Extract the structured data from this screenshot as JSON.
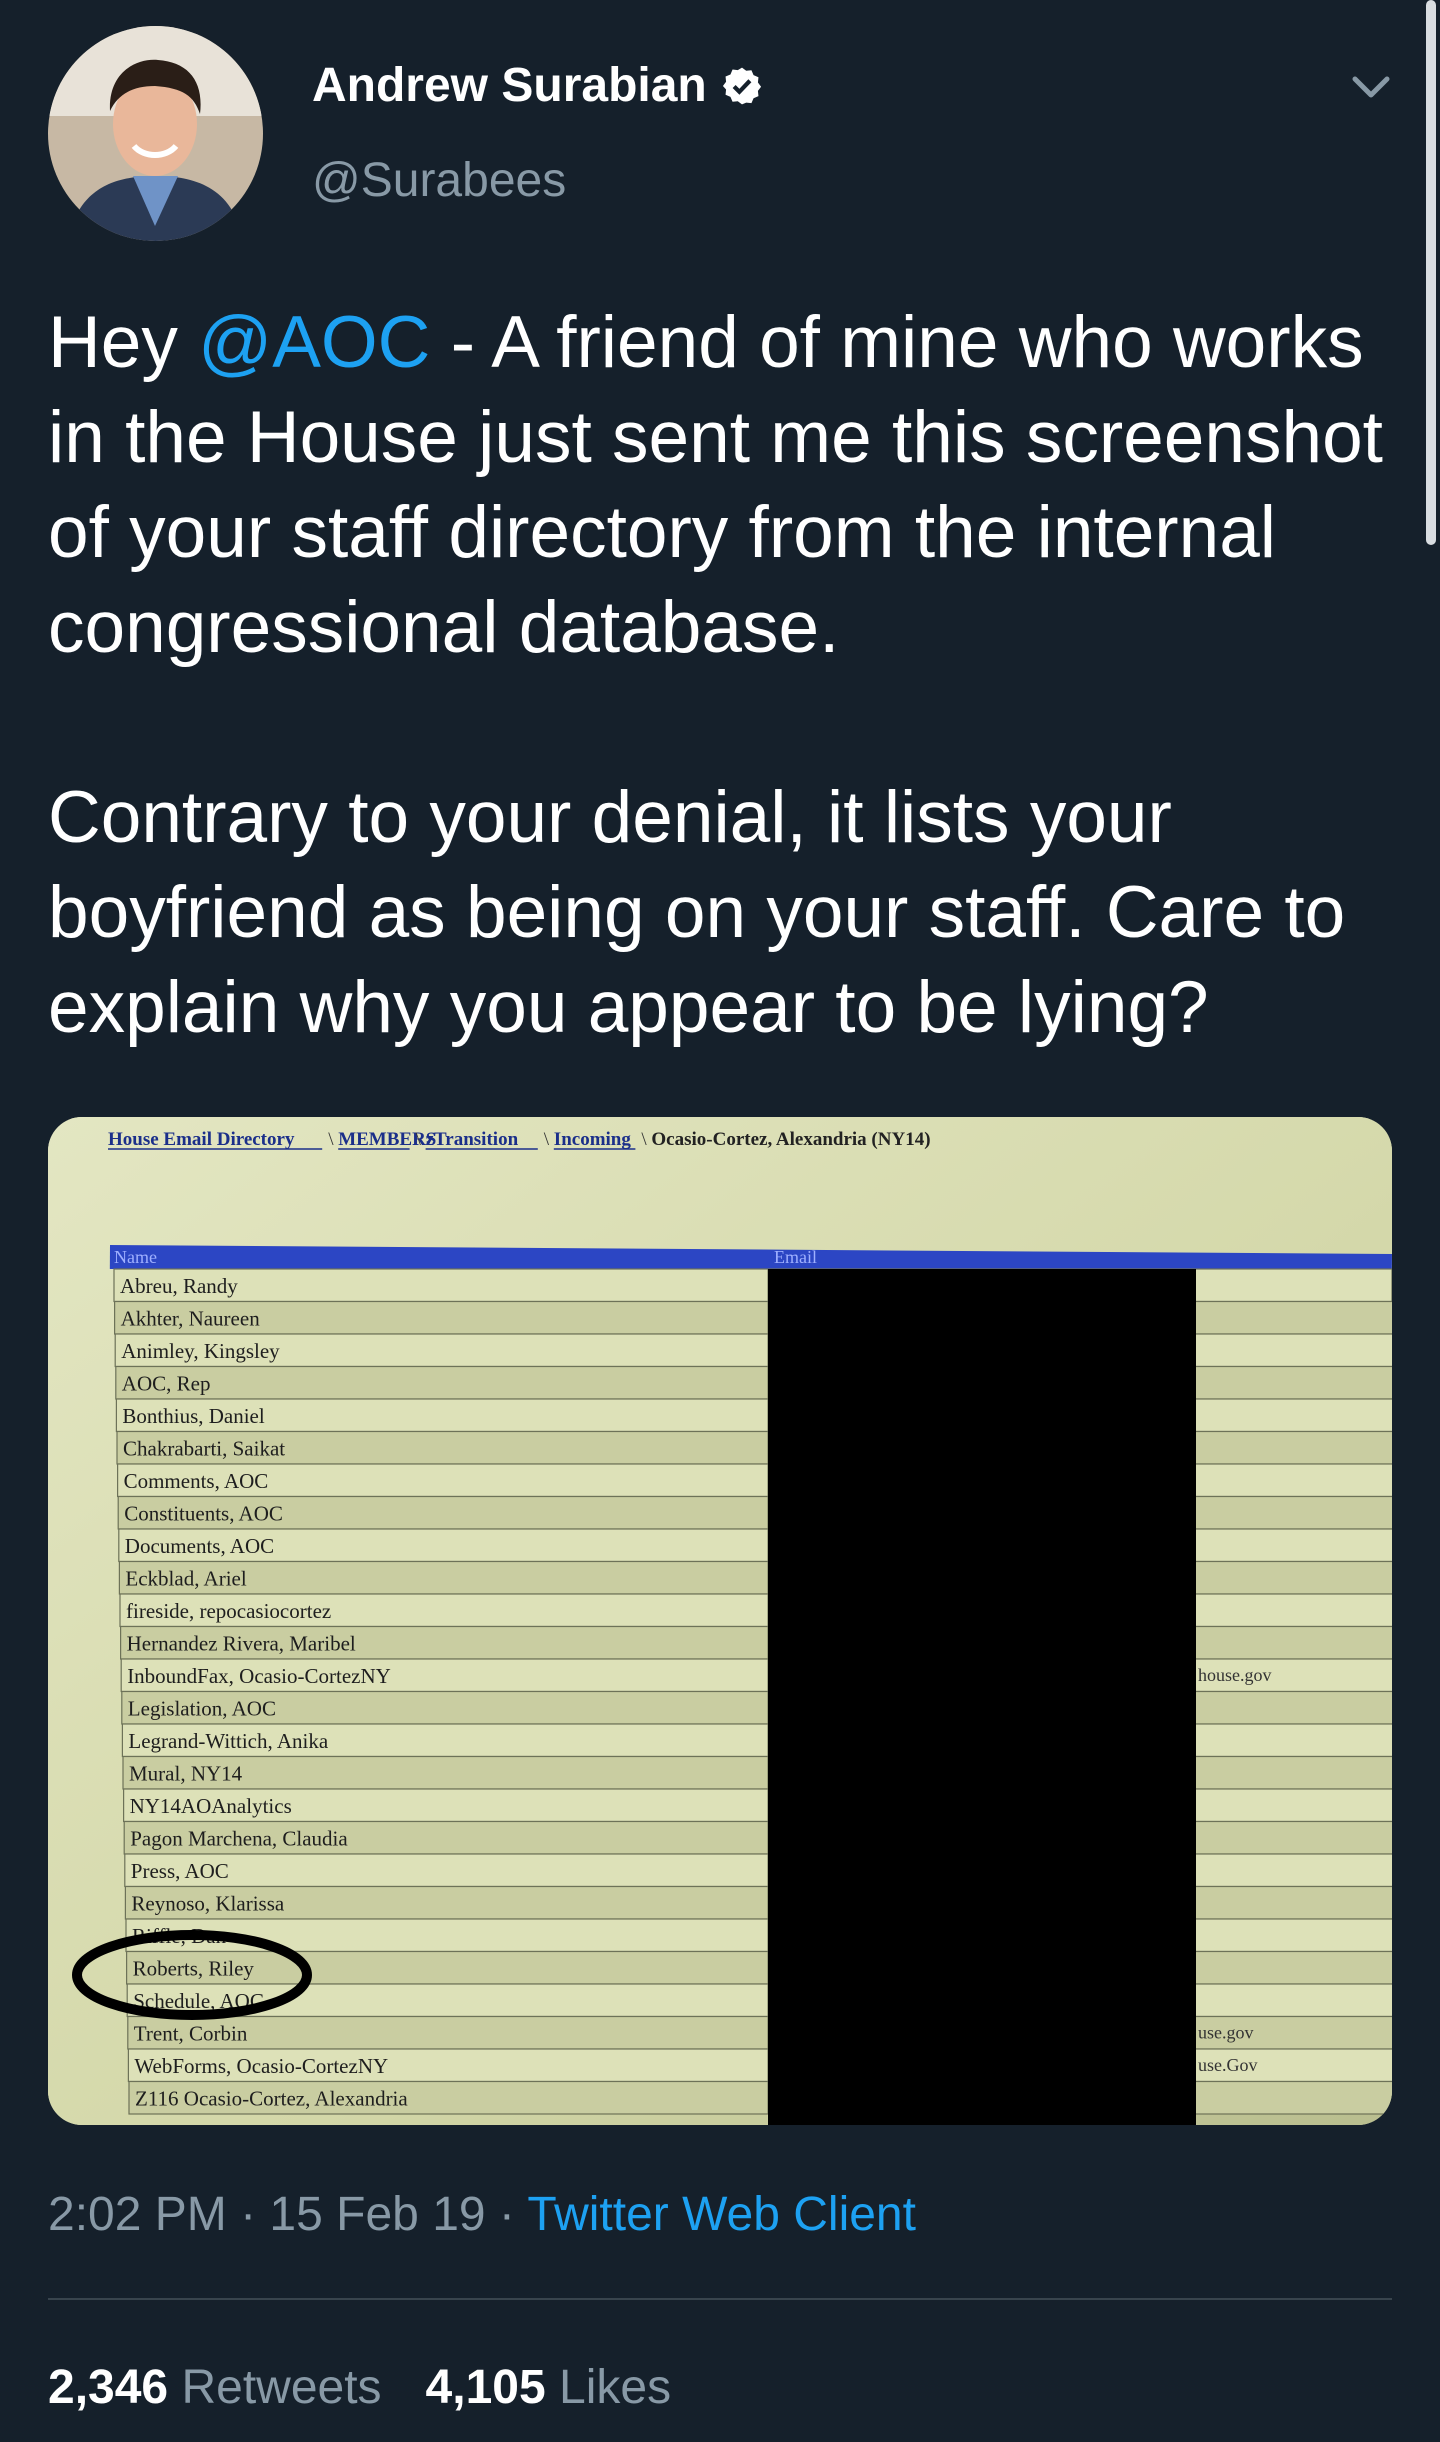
{
  "author": {
    "display_name": "Andrew Surabian",
    "handle": "@Surabees",
    "verified": true,
    "avatar_icon": "profile-photo"
  },
  "tweet": {
    "greeting": "Hey ",
    "mention": "@AOC",
    "line1_rest": " - A friend of mine who works in the House just sent me this screenshot of your staff directory from the internal congressional database.",
    "paragraph2": "Contrary to your denial, it lists your boyfriend as being on your staff. Care to explain why you appear to be lying?"
  },
  "photo": {
    "breadcrumb": {
      "links": [
        "House Email Directory",
        "MEMBERS",
        "zTransition",
        "Incoming"
      ],
      "current": "Ocasio-Cortez, Alexandria (NY14)"
    },
    "columns": [
      "Name",
      "Email"
    ],
    "rows": [
      "Abreu, Randy",
      "Akhter, Naureen",
      "Animley, Kingsley",
      "AOC, Rep",
      "Bonthius, Daniel",
      "Chakrabarti, Saikat",
      "Comments, AOC",
      "Constituents, AOC",
      "Documents, AOC",
      "Eckblad, Ariel",
      "fireside, repocasiocortez",
      "Hernandez Rivera, Maribel",
      "InboundFax, Ocasio-CortezNY",
      "Legislation, AOC",
      "Legrand-Wittich, Anika",
      "Mural, NY14",
      "NY14AOAnalytics",
      "Pagon Marchena, Claudia",
      "Press, AOC",
      "Reynoso, Klarissa",
      "Riffle, Dan",
      "Roberts, Riley",
      "Schedule, AOC",
      "Trent, Corbin",
      "WebForms, Ocasio-CortezNY",
      "Z116 Ocasio-Cortez, Alexandria"
    ],
    "email_fragments": [
      {
        "row": 12,
        "text": "house.gov"
      },
      {
        "row": 23,
        "text": "use.gov"
      },
      {
        "row": 24,
        "text": "use.Gov"
      }
    ],
    "circled_row": 21
  },
  "meta": {
    "time": "2:02 PM",
    "date": "15 Feb 19",
    "separator": " · ",
    "client": "Twitter Web Client"
  },
  "stats": {
    "retweets_count": "2,346",
    "retweets_label": " Retweets",
    "likes_count": "4,105",
    "likes_label": " Likes"
  },
  "colors": {
    "background": "#15202b",
    "link": "#1da1f2",
    "secondary_text": "#8899a6",
    "divider": "#38444d"
  }
}
